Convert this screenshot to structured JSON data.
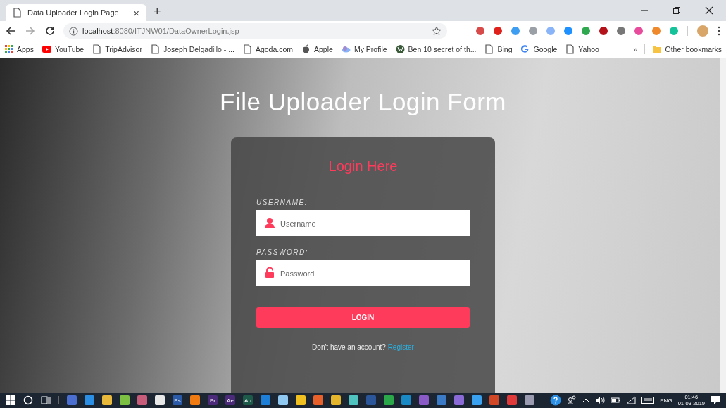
{
  "tab": {
    "title": "Data Uploader Login Page",
    "close": "×",
    "selected": true
  },
  "new_tab": "+",
  "address": {
    "host": "localhost",
    "path": ":8080/ITJNW01/DataOwnerLogin.jsp"
  },
  "extensions": [
    {
      "color": "#d84a4a"
    },
    {
      "color": "#e0201b"
    },
    {
      "color": "#3d9df0"
    },
    {
      "color": "#9aa0a6"
    },
    {
      "color": "#8ab4f8"
    },
    {
      "color": "#1e90ff"
    },
    {
      "color": "#2fa84f"
    },
    {
      "color": "#b3121b"
    },
    {
      "color": "#777777"
    },
    {
      "color": "#e94b9c"
    },
    {
      "color": "#f0892b"
    },
    {
      "color": "#15c39a"
    }
  ],
  "bookmarks": [
    {
      "label": "Apps",
      "kind": "apps"
    },
    {
      "label": "YouTube",
      "kind": "youtube"
    },
    {
      "label": "TripAdvisor",
      "kind": "page"
    },
    {
      "label": "Joseph Delgadillo - ...",
      "kind": "page"
    },
    {
      "label": "Agoda.com",
      "kind": "page"
    },
    {
      "label": "Apple",
      "kind": "apple"
    },
    {
      "label": "My Profile",
      "kind": "profile"
    },
    {
      "label": "Ben 10 secret of th...",
      "kind": "wp"
    },
    {
      "label": "Bing",
      "kind": "page"
    },
    {
      "label": "Google",
      "kind": "google"
    },
    {
      "label": "Yahoo",
      "kind": "page"
    }
  ],
  "bookmarks_overflow": "»",
  "other_bookmarks": "Other bookmarks",
  "page": {
    "title": "File Uploader Login Form",
    "form": {
      "heading": "Login Here",
      "fields": [
        {
          "label": "USERNAME:",
          "placeholder": "Username",
          "kind": "user"
        },
        {
          "label": "PASSWORD:",
          "placeholder": "Password",
          "kind": "lock"
        }
      ],
      "button": "LOGIN",
      "prompt": "Don't have an account?",
      "link": "Register"
    }
  },
  "taskbar": {
    "apps": [
      {
        "color": "#4a6fd1"
      },
      {
        "color": "#2b8fe6"
      },
      {
        "color": "#e8b93a"
      },
      {
        "color": "#7bc043"
      },
      {
        "color": "#c75b7a"
      },
      {
        "color": "#e8e8e8"
      },
      {
        "color": "#2a5aa8",
        "label": "Ps"
      },
      {
        "color": "#f07b12"
      },
      {
        "color": "#4b2a7a",
        "label": "Pr"
      },
      {
        "color": "#4b2a7a",
        "label": "Ae"
      },
      {
        "color": "#1e5a4a",
        "label": "Au"
      },
      {
        "color": "#1e7fd8"
      },
      {
        "color": "#8fc8f0"
      },
      {
        "color": "#f0c020"
      },
      {
        "color": "#e8602a"
      },
      {
        "color": "#e5b62c"
      },
      {
        "color": "#4fc3c0"
      },
      {
        "color": "#2b579a"
      },
      {
        "color": "#2aa84a"
      },
      {
        "color": "#1a8ac6"
      },
      {
        "color": "#8a5ac6"
      },
      {
        "color": "#3a7ac6"
      },
      {
        "color": "#8a6ad6"
      },
      {
        "color": "#3aa0f0"
      },
      {
        "color": "#d24726"
      },
      {
        "color": "#e03a3a"
      },
      {
        "color": "#9a9ab0"
      }
    ],
    "language": "ENG",
    "time": "01:46",
    "date": "01-03-2019"
  }
}
